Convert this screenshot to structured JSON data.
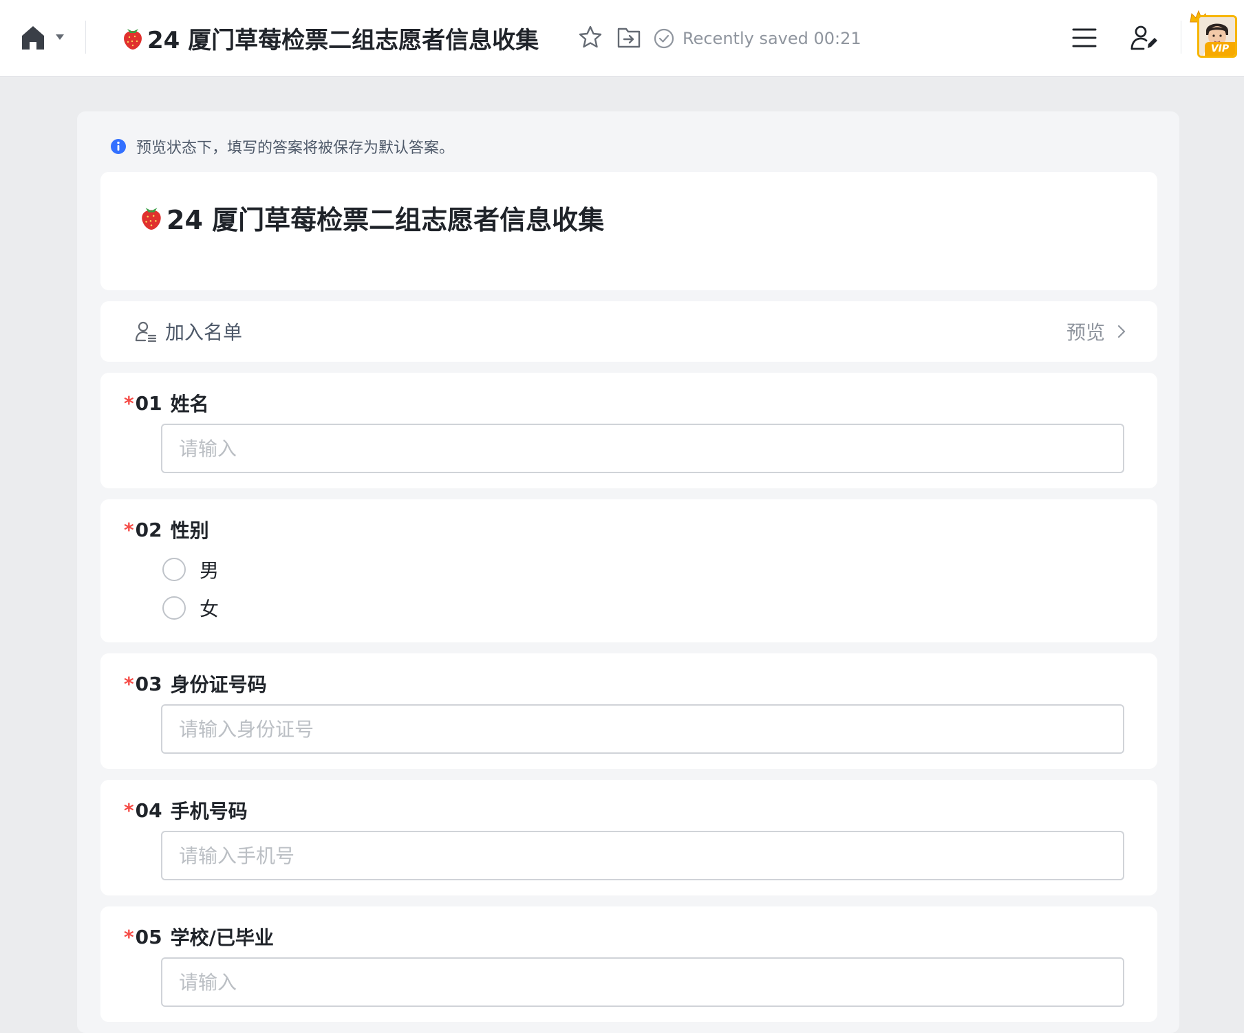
{
  "header": {
    "doc_title": "24 厦门草莓检票二组志愿者信息收集",
    "saved_status": "Recently saved 00:21",
    "vip_label": "VIP"
  },
  "notice": {
    "text": "预览状态下，填写的答案将被保存为默认答案。"
  },
  "form": {
    "title": "24 厦门草莓检票二组志愿者信息收集",
    "list_bar": {
      "label": "加入名单",
      "preview": "预览"
    },
    "questions": [
      {
        "number": "01",
        "label": "姓名",
        "required": "*",
        "placeholder": "请输入"
      },
      {
        "number": "02",
        "label": "性别",
        "required": "*",
        "options": [
          "男",
          "女"
        ]
      },
      {
        "number": "03",
        "label": "身份证号码",
        "required": "*",
        "placeholder": "请输入身份证号"
      },
      {
        "number": "04",
        "label": "手机号码",
        "required": "*",
        "placeholder": "请输入手机号"
      },
      {
        "number": "05",
        "label": "学校/已毕业",
        "required": "*",
        "placeholder": "请输入"
      }
    ]
  },
  "colors": {
    "required": "#f54a45",
    "info": "#3370ff",
    "vip": "#f7a900"
  }
}
